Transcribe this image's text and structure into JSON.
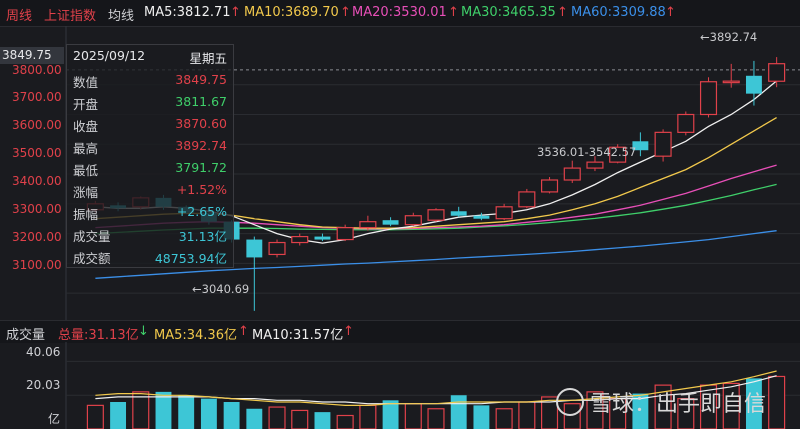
{
  "header": {
    "tab_weekly": "周线",
    "index_name": "上证指数",
    "ma_toggle": "均线",
    "ma5": "MA5:3812.71",
    "ma10": "MA10:3689.70",
    "ma20": "MA20:3530.01",
    "ma30": "MA30:3465.35",
    "ma60": "MA60:3309.88"
  },
  "price_axis": {
    "current_price_label": "3849.75",
    "tick_labels": [
      "3800.00",
      "3700.00",
      "3600.00",
      "3500.00",
      "3400.00",
      "3300.00",
      "3200.00",
      "3100.00"
    ]
  },
  "annotations": {
    "high_mark": "3892.74",
    "low_mark": "3040.69",
    "gap_label": "3536.01-3542.57"
  },
  "tooltip": {
    "date": "2025/09/12",
    "weekday": "星期五",
    "rows": [
      {
        "label": "数值",
        "value": "3849.75"
      },
      {
        "label": "开盘",
        "value": "3811.67"
      },
      {
        "label": "收盘",
        "value": "3870.60"
      },
      {
        "label": "最高",
        "value": "3892.74"
      },
      {
        "label": "最低",
        "value": "3791.72"
      },
      {
        "label": "涨幅",
        "value": "+1.52%"
      },
      {
        "label": "振幅",
        "value": "+2.65%"
      },
      {
        "label": "成交量",
        "value": "31.13亿"
      },
      {
        "label": "成交额",
        "value": "48753.94亿"
      }
    ]
  },
  "volume_header": {
    "title": "成交量",
    "total": "总量:31.13亿",
    "ma5": "MA5:34.36亿",
    "ma10": "MA10:31.57亿"
  },
  "volume_axis": {
    "tick_labels": [
      "40.06",
      "20.03",
      "亿"
    ]
  },
  "watermark": "雪球：出手即自信",
  "colors": {
    "up": "#e0414a",
    "down": "#3dc6d6",
    "ma5": "#f0f0f0",
    "ma10": "#f2c94c",
    "ma20": "#e84fb8",
    "ma30": "#3fcf6a",
    "ma60": "#3b8fe8",
    "bg": "#1a1b1f"
  },
  "chart_data": {
    "type": "candlestick",
    "period": "weekly",
    "ylim": [
      3030,
      3930
    ],
    "candles": [
      {
        "o": 3380,
        "c": 3400,
        "h": 3410,
        "l": 3370
      },
      {
        "o": 3395,
        "c": 3385,
        "h": 3405,
        "l": 3375
      },
      {
        "o": 3390,
        "c": 3420,
        "h": 3425,
        "l": 3380
      },
      {
        "o": 3420,
        "c": 3390,
        "h": 3430,
        "l": 3380
      },
      {
        "o": 3390,
        "c": 3370,
        "h": 3395,
        "l": 3365
      },
      {
        "o": 3370,
        "c": 3340,
        "h": 3375,
        "l": 3330
      },
      {
        "o": 3340,
        "c": 3280,
        "h": 3345,
        "l": 3270
      },
      {
        "o": 3280,
        "c": 3220,
        "h": 3290,
        "l": 3040.69
      },
      {
        "o": 3230,
        "c": 3270,
        "h": 3280,
        "l": 3220
      },
      {
        "o": 3270,
        "c": 3290,
        "h": 3300,
        "l": 3260
      },
      {
        "o": 3290,
        "c": 3280,
        "h": 3300,
        "l": 3275
      },
      {
        "o": 3280,
        "c": 3320,
        "h": 3330,
        "l": 3275
      },
      {
        "o": 3320,
        "c": 3340,
        "h": 3360,
        "l": 3310
      },
      {
        "o": 3345,
        "c": 3330,
        "h": 3355,
        "l": 3325
      },
      {
        "o": 3330,
        "c": 3360,
        "h": 3370,
        "l": 3325
      },
      {
        "o": 3345,
        "c": 3380,
        "h": 3385,
        "l": 3340
      },
      {
        "o": 3375,
        "c": 3360,
        "h": 3390,
        "l": 3355
      },
      {
        "o": 3360,
        "c": 3350,
        "h": 3370,
        "l": 3345
      },
      {
        "o": 3350,
        "c": 3390,
        "h": 3400,
        "l": 3345
      },
      {
        "o": 3390,
        "c": 3440,
        "h": 3450,
        "l": 3385
      },
      {
        "o": 3440,
        "c": 3480,
        "h": 3490,
        "l": 3435
      },
      {
        "o": 3480,
        "c": 3520,
        "h": 3545,
        "l": 3470
      },
      {
        "o": 3520,
        "c": 3540,
        "h": 3560,
        "l": 3510
      },
      {
        "o": 3540,
        "c": 3590,
        "h": 3600,
        "l": 3536
      },
      {
        "o": 3610,
        "c": 3580,
        "h": 3640,
        "l": 3560
      },
      {
        "o": 3560,
        "c": 3640,
        "h": 3650,
        "l": 3542
      },
      {
        "o": 3640,
        "c": 3700,
        "h": 3710,
        "l": 3630
      },
      {
        "o": 3700,
        "c": 3810,
        "h": 3825,
        "l": 3690
      },
      {
        "o": 3810,
        "c": 3812,
        "h": 3870,
        "l": 3790
      },
      {
        "o": 3830,
        "c": 3770,
        "h": 3880,
        "l": 3730
      },
      {
        "o": 3811.67,
        "c": 3870.6,
        "h": 3892.74,
        "l": 3791.72
      }
    ],
    "ma": {
      "ma5": [
        3390,
        3385,
        3385,
        3390,
        3385,
        3375,
        3360,
        3330,
        3300,
        3280,
        3268,
        3280,
        3300,
        3315,
        3325,
        3340,
        3355,
        3362,
        3368,
        3380,
        3400,
        3430,
        3465,
        3505,
        3540,
        3575,
        3610,
        3660,
        3700,
        3750,
        3812.71
      ],
      "ma10": [
        3350,
        3355,
        3360,
        3365,
        3368,
        3368,
        3362,
        3350,
        3340,
        3330,
        3322,
        3320,
        3318,
        3318,
        3320,
        3325,
        3330,
        3335,
        3340,
        3350,
        3362,
        3380,
        3400,
        3425,
        3455,
        3485,
        3515,
        3555,
        3600,
        3645,
        3689.7
      ],
      "ma20": [
        3320,
        3325,
        3330,
        3335,
        3338,
        3340,
        3338,
        3335,
        3330,
        3325,
        3320,
        3318,
        3316,
        3316,
        3317,
        3320,
        3322,
        3325,
        3330,
        3338,
        3345,
        3355,
        3365,
        3380,
        3395,
        3415,
        3435,
        3460,
        3485,
        3508,
        3530.01
      ],
      "ma30": [
        3300,
        3304,
        3308,
        3312,
        3315,
        3318,
        3318,
        3318,
        3317,
        3315,
        3314,
        3313,
        3313,
        3313,
        3314,
        3316,
        3318,
        3322,
        3326,
        3331,
        3337,
        3344,
        3351,
        3360,
        3370,
        3382,
        3395,
        3411,
        3428,
        3447,
        3465.35
      ],
      "ma60": [
        3150,
        3155,
        3160,
        3165,
        3170,
        3175,
        3179,
        3183,
        3186,
        3190,
        3194,
        3198,
        3201,
        3205,
        3209,
        3213,
        3218,
        3222,
        3226,
        3230,
        3235,
        3240,
        3246,
        3252,
        3258,
        3265,
        3272,
        3280,
        3290,
        3300,
        3309.88
      ]
    },
    "volume": {
      "ylim": [
        0,
        48
      ],
      "values": [
        14,
        16,
        22,
        22,
        20,
        18,
        16,
        12,
        13,
        11,
        10,
        8,
        14,
        17,
        15,
        12,
        20,
        14,
        12,
        16,
        19,
        15,
        22,
        18,
        21,
        26,
        18,
        26,
        27,
        30,
        31.13
      ],
      "ma5": [
        20,
        21,
        21,
        20,
        20,
        19,
        18,
        17,
        16,
        16,
        15,
        14,
        14,
        15,
        15,
        15,
        16,
        16,
        16,
        16,
        17,
        17,
        18,
        19,
        20,
        22,
        24,
        26,
        28,
        31,
        34.36
      ],
      "ma10": [
        18,
        19,
        19,
        19,
        19,
        19,
        18,
        18,
        17,
        17,
        16,
        16,
        15,
        15,
        15,
        15,
        15,
        15,
        16,
        16,
        16,
        17,
        17,
        18,
        18,
        20,
        21,
        23,
        25,
        28,
        31.57
      ]
    }
  }
}
